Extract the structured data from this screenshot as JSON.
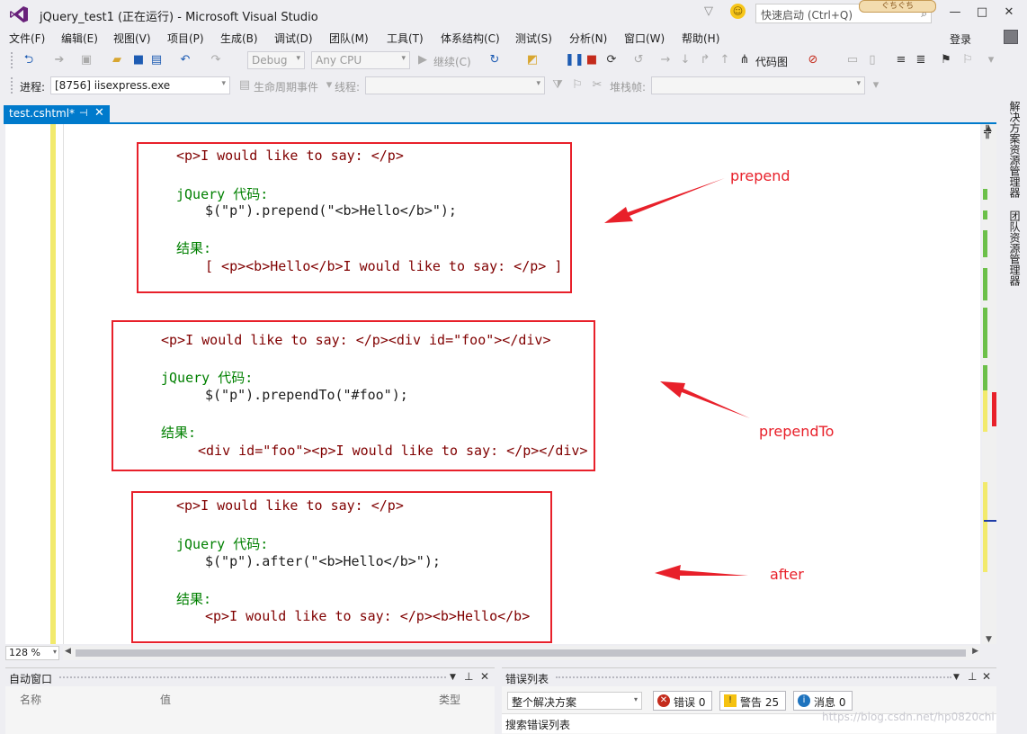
{
  "window": {
    "title": "jQuery_test1 (正在运行) - Microsoft Visual Studio",
    "quick_launch_placeholder": "快速启动 (Ctrl+Q)",
    "badge": "ぐちぐち"
  },
  "menu": {
    "items": [
      "文件(F)",
      "编辑(E)",
      "视图(V)",
      "项目(P)",
      "生成(B)",
      "调试(D)",
      "团队(M)",
      "工具(T)",
      "体系结构(C)",
      "测试(S)",
      "分析(N)",
      "窗口(W)",
      "帮助(H)"
    ],
    "login": "登录"
  },
  "toolbar": {
    "config": "Debug",
    "platform": "Any CPU",
    "continue": "继续(C)",
    "code_map": "代码图"
  },
  "debug_bar": {
    "process_label": "进程:",
    "process_value": "[8756] iisexpress.exe",
    "lifecycle": "生命周期事件",
    "thread_label": "线程:",
    "stack_label": "堆栈帧:"
  },
  "doc_tab": {
    "name": "test.cshtml*"
  },
  "code": {
    "block1": {
      "line1": "<p>I would like to say: </p>",
      "line2_kw": "jQuery 代码:",
      "line3": "$(\"p\").prepend(\"<b>Hello</b>\");",
      "line4_kw": "结果:",
      "line5": "[ <p><b>Hello</b>I would like to say: </p> ]"
    },
    "block2": {
      "line1": "<p>I would like to say: </p><div id=\"foo\"></div>",
      "line2_kw": "jQuery 代码:",
      "line3": "$(\"p\").prependTo(\"#foo\");",
      "line4_kw": "结果:",
      "line5": "<div id=\"foo\"><p>I would like to say: </p></div>"
    },
    "block3": {
      "line1": "<p>I would like to say: </p>",
      "line2_kw": "jQuery 代码:",
      "line3": "$(\"p\").after(\"<b>Hello</b>\");",
      "line4_kw": "结果:",
      "line5": "<p>I would like to say: </p><b>Hello</b>"
    }
  },
  "annotations": {
    "prepend": "prepend",
    "prependTo": "prependTo",
    "after": "after",
    "color": "#e8202a"
  },
  "zoom": "128 %",
  "side_panels": {
    "solution_explorer": "解决方案资源管理器",
    "team_explorer": "团队资源管理器"
  },
  "autos": {
    "title": "自动窗口",
    "columns": [
      "名称",
      "值",
      "类型"
    ]
  },
  "error_list": {
    "title": "错误列表",
    "scope": "整个解决方案",
    "errors": "错误 0",
    "warnings": "警告 25",
    "messages": "消息 0",
    "search_placeholder": "搜索错误列表"
  },
  "watermark": "https://blog.csdn.net/hp0820chi"
}
